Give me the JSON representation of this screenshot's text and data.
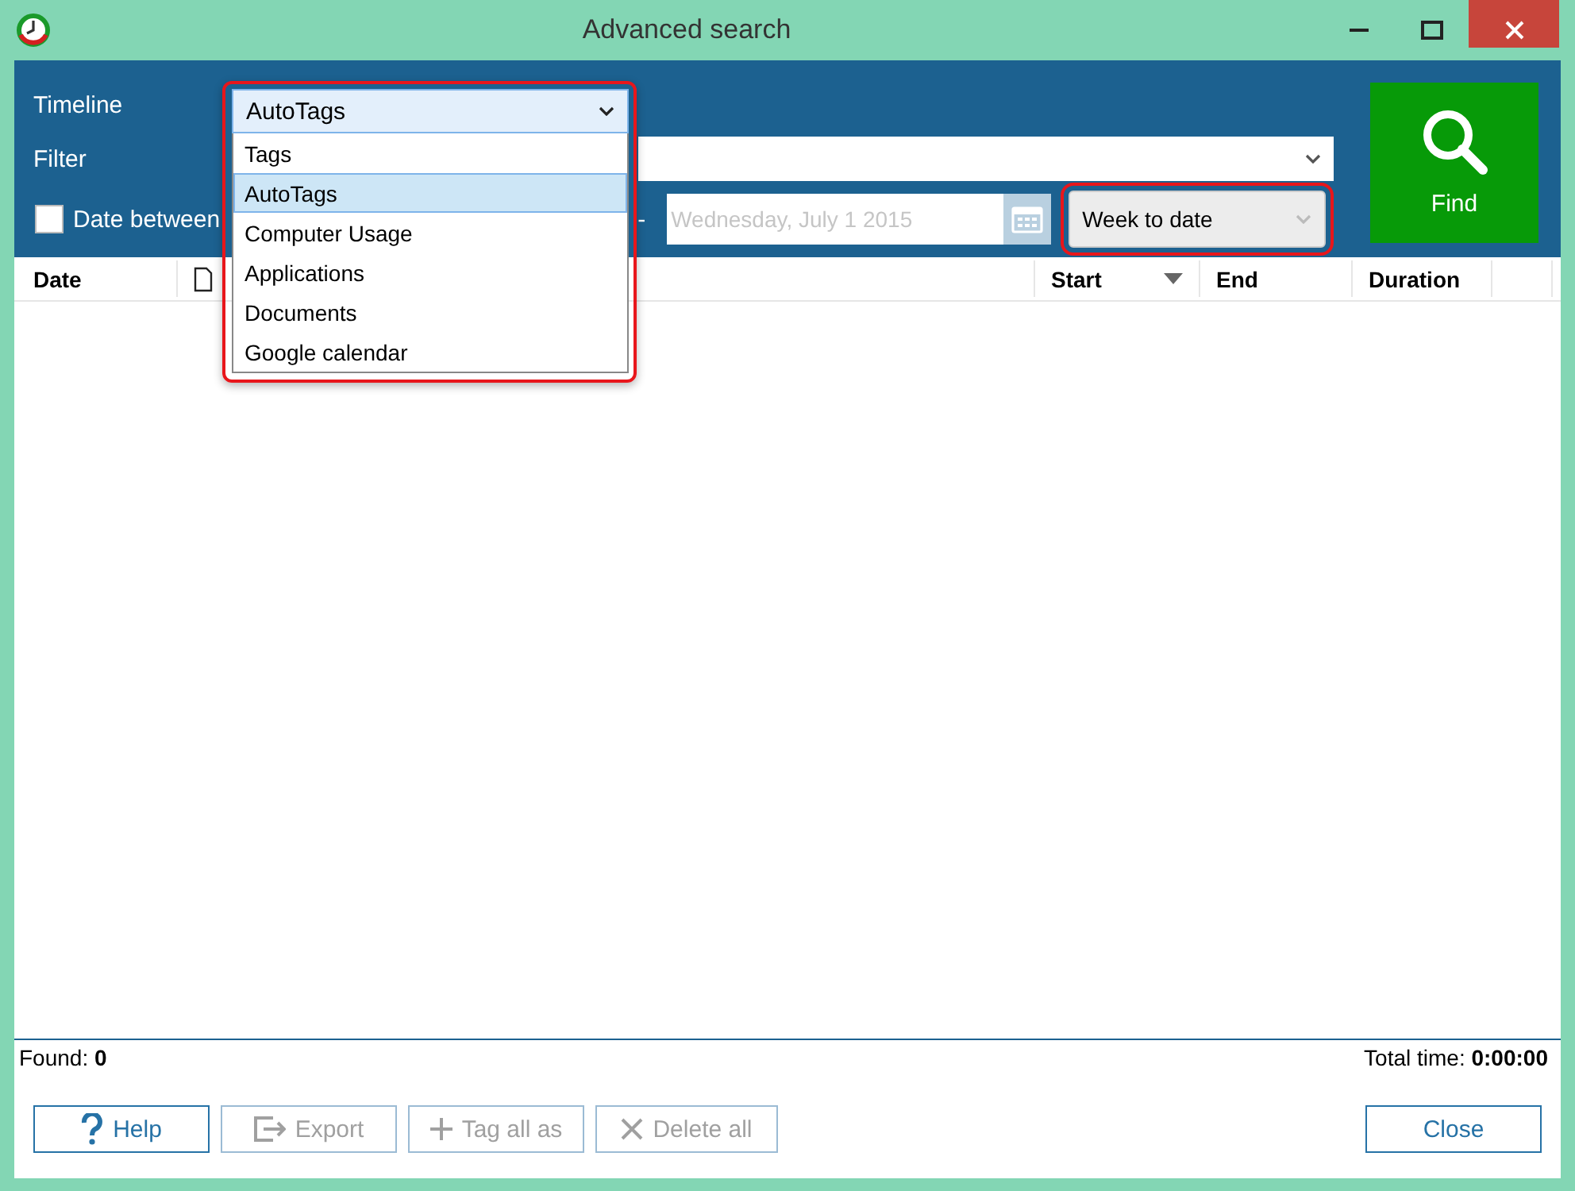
{
  "window": {
    "title": "Advanced search"
  },
  "timeline": {
    "label": "Timeline",
    "value": "AutoTags",
    "highlighted": true,
    "options": [
      {
        "label": "Tags",
        "selected": false
      },
      {
        "label": "AutoTags",
        "selected": true
      },
      {
        "label": "Computer Usage",
        "selected": false
      },
      {
        "label": "Applications",
        "selected": false
      },
      {
        "label": "Documents",
        "selected": false
      },
      {
        "label": "Google calendar",
        "selected": false
      }
    ]
  },
  "filter": {
    "label": "Filter"
  },
  "date_between": {
    "label": "Date between",
    "checked": false,
    "separator": "-",
    "end_date": "Wednesday, July 1 2015",
    "disabled": true
  },
  "period": {
    "value": "Week to date",
    "highlighted": true
  },
  "find_button": {
    "label": "Find"
  },
  "table": {
    "columns": [
      {
        "kind": "text",
        "label": "Date",
        "sorted": false
      },
      {
        "kind": "icon"
      },
      {
        "kind": "gap"
      },
      {
        "kind": "text",
        "label": "Start",
        "sorted": true
      },
      {
        "kind": "text",
        "label": "End",
        "sorted": false
      },
      {
        "kind": "text",
        "label": "Duration",
        "sorted": false
      },
      {
        "kind": "gap"
      }
    ]
  },
  "status": {
    "found": "Found: **0**",
    "total": "Total time: **0:00:00**"
  },
  "buttons": [
    {
      "kind": "help",
      "label": "Help",
      "disabled": false
    },
    {
      "kind": "export",
      "label": "Export",
      "disabled": true
    },
    {
      "kind": "tag",
      "label": "Tag all as",
      "disabled": true
    },
    {
      "kind": "delete",
      "label": "Delete all",
      "disabled": true
    },
    {
      "kind": "close",
      "label": "Close",
      "disabled": false
    }
  ]
}
